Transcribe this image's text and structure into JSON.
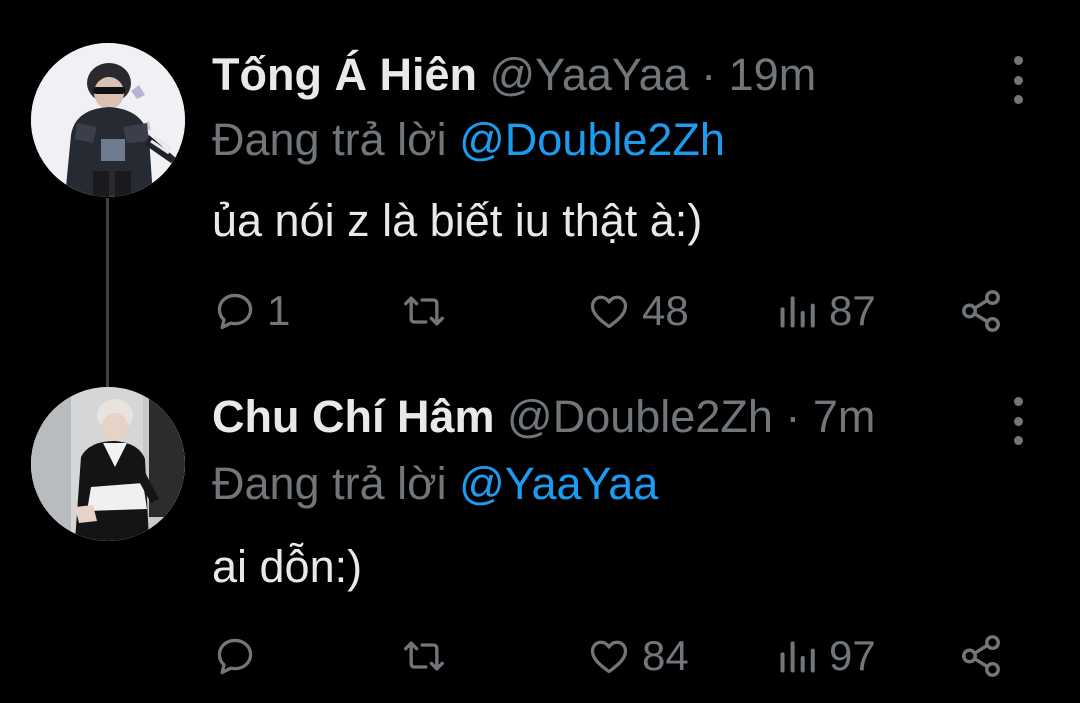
{
  "tweets": [
    {
      "name": "Tống Á Hiên",
      "handle": "@YaaYaa",
      "separator": "·",
      "time": "19m",
      "reply_prefix": "Đang trả lời",
      "reply_mention": "@Double2Zh",
      "text": "ủa nói z là biết iu thật à:)",
      "replies": "1",
      "retweets": "",
      "likes": "48",
      "views": "87"
    },
    {
      "name": "Chu Chí Hâm",
      "handle": "@Double2Zh",
      "separator": "·",
      "time": "7m",
      "reply_prefix": "Đang trả lời",
      "reply_mention": "@YaaYaa",
      "text": "ai dỗn:)",
      "replies": "",
      "retweets": "",
      "likes": "84",
      "views": "97"
    }
  ],
  "colors": {
    "background": "#000000",
    "text": "#e7e9ea",
    "muted": "#71767b",
    "mention": "#1d9bf0",
    "thread_line": "#3e4144"
  },
  "icons": [
    "reply-icon",
    "retweet-icon",
    "like-icon",
    "views-icon",
    "share-icon",
    "more-options-icon"
  ]
}
